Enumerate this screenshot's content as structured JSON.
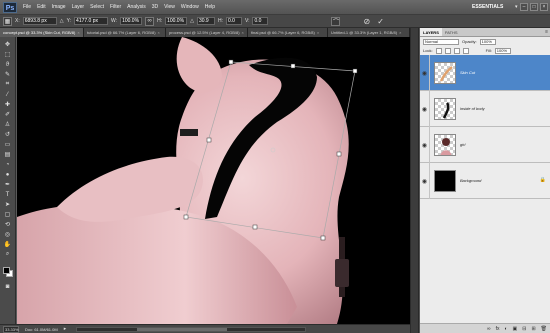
{
  "app": {
    "logo": "Ps"
  },
  "menubar": {
    "items": [
      "File",
      "Edit",
      "Image",
      "Layer",
      "Select",
      "Filter",
      "Analysis",
      "3D",
      "View",
      "Window",
      "Help"
    ],
    "workspace": "ESSENTIALS",
    "workspace_arrow": "▾",
    "win_buttons": [
      "–",
      "□",
      "×"
    ]
  },
  "options": {
    "x_label": "X:",
    "x_value": "6893.8 px",
    "y_label": "Y:",
    "y_value": "4177.0 px",
    "w_label": "W:",
    "w_value": "100.0%",
    "h_label": "H:",
    "h_value": "100.0%",
    "angle_label": "△",
    "angle_value": "30.9",
    "hskew_label": "H:",
    "hskew_value": "0.0",
    "vskew_label": "V:",
    "vskew_value": "0.0",
    "cancel_symbol": "⊘",
    "commit_symbol": "✓"
  },
  "tabs": [
    {
      "label": "concept.psd @ 33.3% (Skin Cut, RGB/8)",
      "close": "×"
    },
    {
      "label": "tutorial.psd @ 66.7% (Layer 6, RGB/8)",
      "close": "×"
    },
    {
      "label": "process.psd @ 12.5% (Layer 4, RGB/8)",
      "close": "×"
    },
    {
      "label": "final.psd @ 66.7% (Layer 6, RGB/8)",
      "close": "×"
    },
    {
      "label": "Untitled-1 @ 33.3% (Layer 1, RGB/8)",
      "close": "×"
    }
  ],
  "status": {
    "zoom": "33.33%",
    "doc": "Doc: 61.0M/61.0M",
    "arrow": "▸"
  },
  "layers_panel": {
    "tabs": [
      "LAYERS",
      "PATHS"
    ],
    "menu_symbol": "≡",
    "blend_mode": "Normal",
    "opacity_label": "Opacity:",
    "opacity_value": "100%",
    "lock_label": "Lock:",
    "fill_label": "Fill:",
    "fill_value": "100%",
    "layers": [
      {
        "name": "Skin Cut",
        "selected": true,
        "visible": true
      },
      {
        "name": "inside of body",
        "selected": false,
        "visible": true
      },
      {
        "name": "girl",
        "selected": false,
        "visible": true
      },
      {
        "name": "Background",
        "selected": false,
        "visible": true,
        "locked": true
      }
    ],
    "eye_symbol": "◉",
    "lock_symbol": "🔒",
    "footer_icons": [
      "∞",
      "fx",
      "◐",
      "▣",
      "⊟",
      "⊞",
      "🗑"
    ]
  },
  "colors": {
    "selected_layer": "#4d86c9",
    "canvas_bg": "#000000",
    "foreground_swatch": "#000000",
    "background_swatch": "#ffffff"
  }
}
